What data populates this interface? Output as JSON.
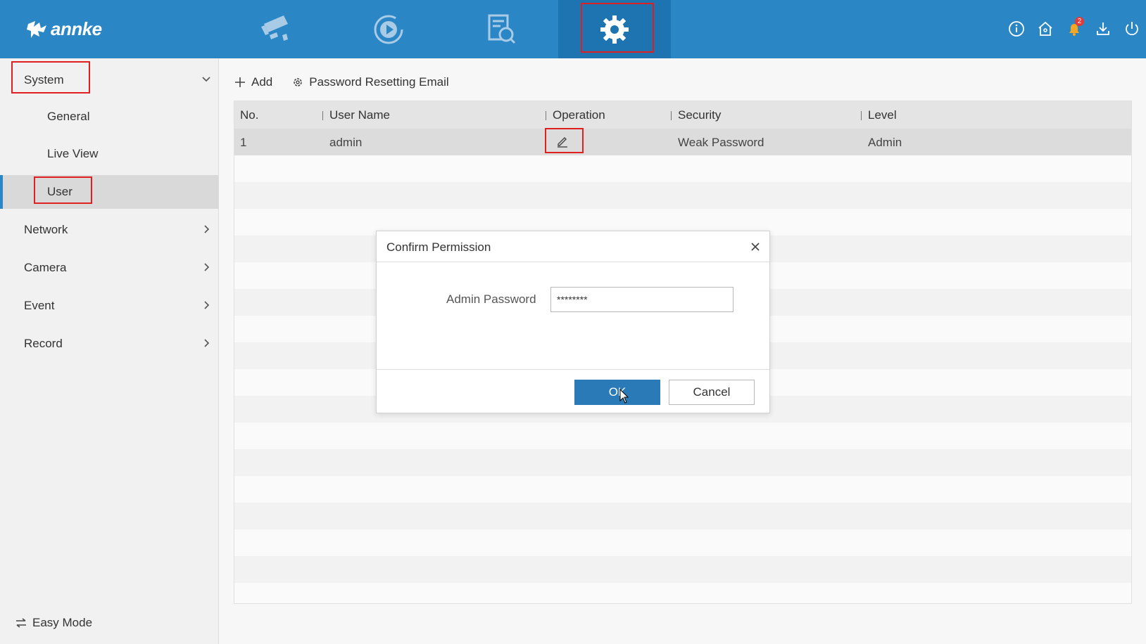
{
  "brand": {
    "name": "annke"
  },
  "topbar": {
    "tabs": [
      {
        "name": "live-view",
        "icon": "camera-icon"
      },
      {
        "name": "playback",
        "icon": "playback-icon"
      },
      {
        "name": "search",
        "icon": "file-search-icon"
      },
      {
        "name": "configuration",
        "icon": "gear-icon",
        "active": true
      }
    ],
    "actions": [
      {
        "icon": "info-icon"
      },
      {
        "icon": "home-icon"
      },
      {
        "icon": "bell-icon",
        "badge": "2"
      },
      {
        "icon": "download-icon"
      },
      {
        "icon": "power-icon"
      }
    ]
  },
  "sidebar": {
    "system": "System",
    "general": "General",
    "live_view": "Live View",
    "user": "User",
    "network": "Network",
    "camera": "Camera",
    "event": "Event",
    "record": "Record",
    "easy_mode": "Easy Mode"
  },
  "toolbar": {
    "add": "Add",
    "password_reset_email": "Password Resetting Email"
  },
  "table": {
    "headers": {
      "no": "No.",
      "user_name": "User Name",
      "operation": "Operation",
      "security": "Security",
      "level": "Level"
    },
    "rows": [
      {
        "no": "1",
        "user_name": "admin",
        "security": "Weak Password",
        "level": "Admin"
      }
    ]
  },
  "dialog": {
    "title": "Confirm Permission",
    "field_label": "Admin Password",
    "field_value": "********",
    "ok": "OK",
    "cancel": "Cancel"
  },
  "colors": {
    "header_blue": "#2a86c5",
    "active_tab_blue": "#1e74b0",
    "ok_button": "#2a7ab8",
    "highlight_red": "#e02020",
    "badge_red": "#e53935"
  }
}
